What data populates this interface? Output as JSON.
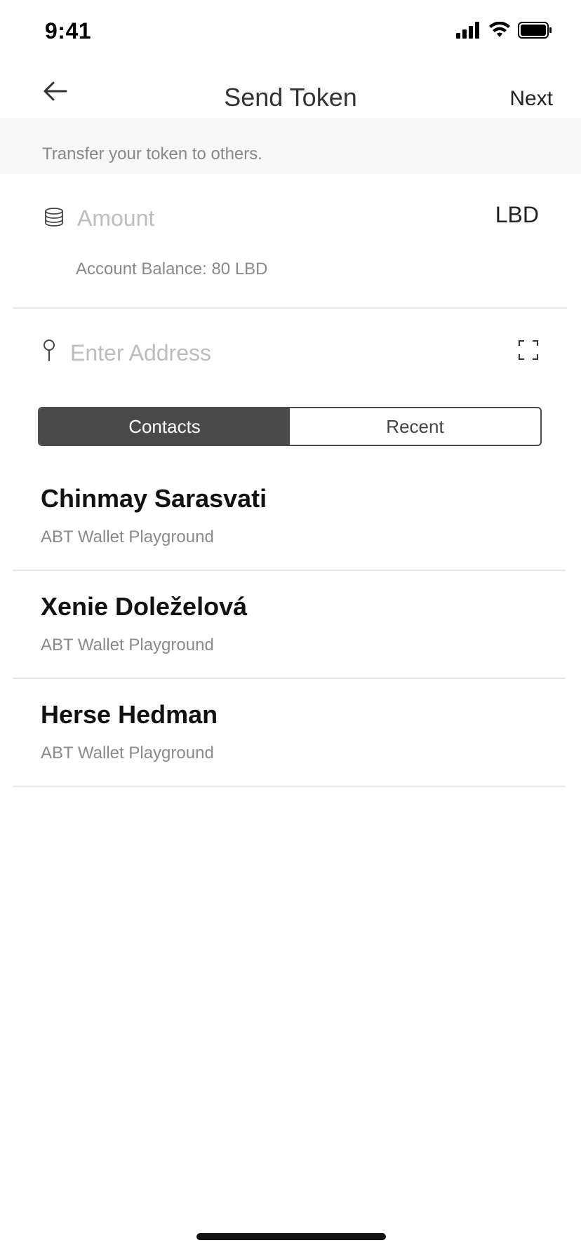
{
  "status_bar": {
    "time": "9:41"
  },
  "nav": {
    "title": "Send Token",
    "next_label": "Next"
  },
  "subtitle": "Transfer your token to others.",
  "amount": {
    "placeholder": "Amount",
    "unit": "LBD",
    "balance_text": "Account Balance: 80 LBD"
  },
  "address": {
    "placeholder": "Enter Address"
  },
  "tabs": [
    {
      "label": "Contacts",
      "active": true
    },
    {
      "label": "Recent",
      "active": false
    }
  ],
  "contacts": [
    {
      "name": "Chinmay Sarasvati",
      "subtitle": "ABT Wallet Playground"
    },
    {
      "name": "Xenie Doleželová",
      "subtitle": "ABT Wallet Playground"
    },
    {
      "name": "Herse Hedman",
      "subtitle": "ABT Wallet Playground"
    }
  ],
  "icons": {
    "back": "arrow-left-icon",
    "amount": "coins-icon",
    "address": "pin-icon",
    "scan": "scan-icon"
  }
}
